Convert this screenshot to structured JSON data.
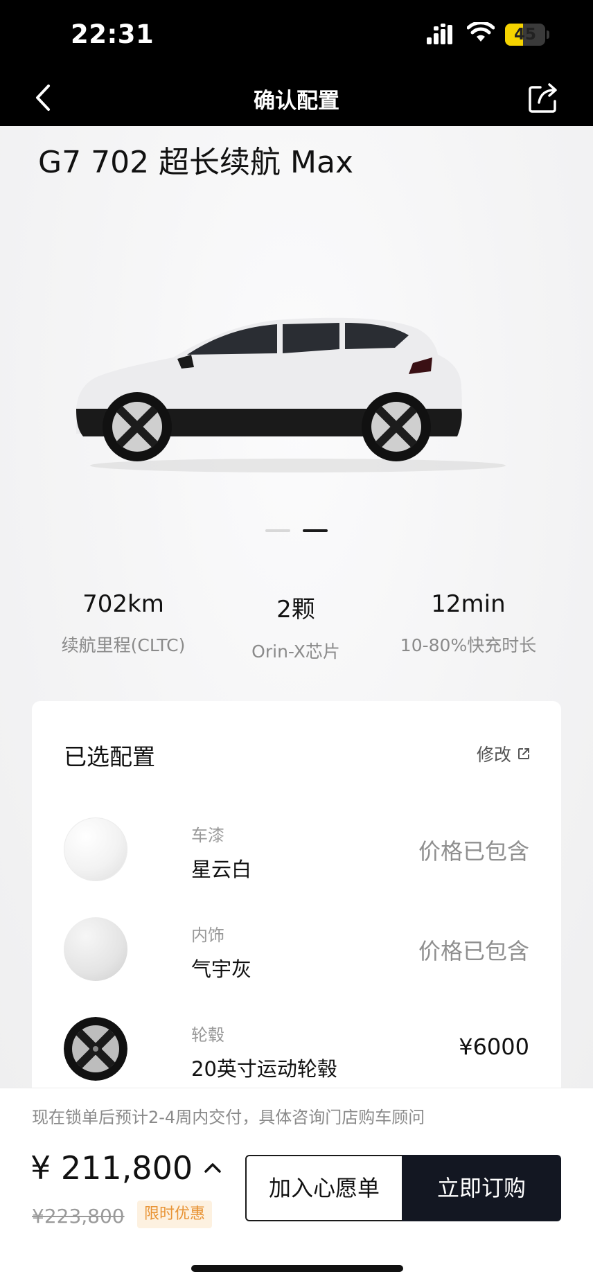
{
  "status_bar": {
    "time": "22:31",
    "battery": "45",
    "battery_level": 0.45
  },
  "nav": {
    "title": "确认配置",
    "back_icon": "chevron-left-icon",
    "share_icon": "share-icon"
  },
  "hero": {
    "model_title": "G7 702 超长续航 Max",
    "carousel": {
      "total": 2,
      "active": 2
    },
    "specs": [
      {
        "value": "702km",
        "label": "续航里程(CLTC)"
      },
      {
        "value": "2颗",
        "label": "Orin-X芯片"
      },
      {
        "value": "12min",
        "label": "10-80%快充时长"
      }
    ]
  },
  "config": {
    "title": "已选配置",
    "edit_label": "修改",
    "options": [
      {
        "category": "车漆",
        "name": "星云白",
        "price": "价格已包含"
      },
      {
        "category": "内饰",
        "name": "气宇灰",
        "price": "价格已包含"
      },
      {
        "category": "轮毂",
        "name": "20英寸运动轮毂",
        "price": "¥6000"
      }
    ]
  },
  "bottom": {
    "notice": "现在锁单后预计2-4周内交付，具体咨询门店购车顾问",
    "price": "¥ 211,800",
    "original_price": "¥223,800",
    "promo_tag": "限时优惠",
    "wishlist_label": "加入心愿单",
    "order_label": "立即订购"
  },
  "colors": {
    "accent_dark": "#131722",
    "promo_text": "#e89334",
    "promo_bg": "#fdf1e0",
    "battery": "#f5d300"
  }
}
